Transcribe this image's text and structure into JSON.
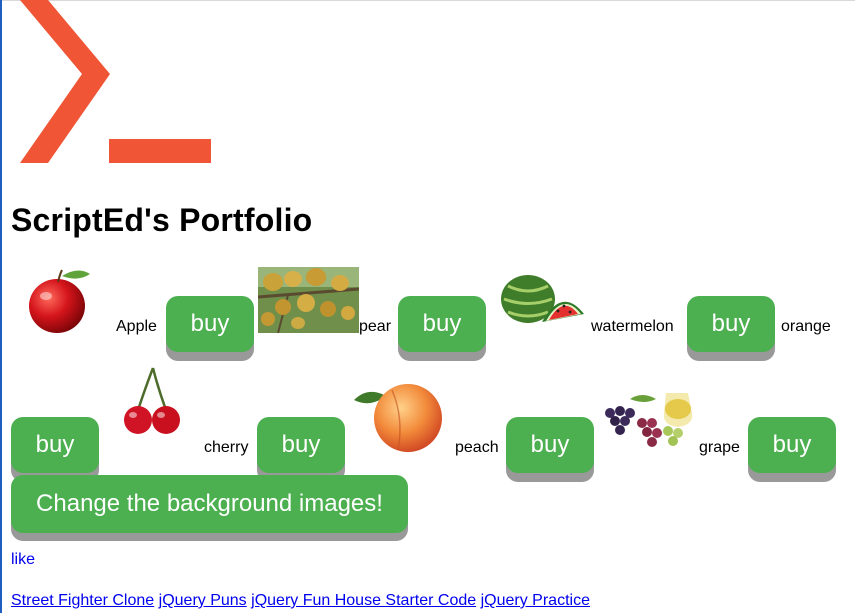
{
  "page": {
    "title": "ScriptEd's Portfolio",
    "brand_color": "#f05535",
    "button_color": "#4caf50",
    "button_shadow_color": "#999999",
    "link_color": "#0000ee"
  },
  "logo": {
    "icon": "terminal-prompt-icon"
  },
  "fruits": [
    {
      "label": "Apple",
      "button": "buy",
      "icon": "apple-image"
    },
    {
      "label": "pear",
      "button": "buy",
      "icon": "pear-tree-image"
    },
    {
      "label": "watermelon",
      "button": "buy",
      "icon": "watermelon-image"
    },
    {
      "label": "orange",
      "button": "buy",
      "icon": "orange-image"
    },
    {
      "label": "cherry",
      "button": "buy",
      "icon": "cherry-image"
    },
    {
      "label": "peach",
      "button": "buy",
      "icon": "peach-image"
    },
    {
      "label": "grape",
      "button": "buy",
      "icon": "grape-image"
    }
  ],
  "change_button": "Change the background images!",
  "like_link": "like",
  "footer_links": [
    "Street Fighter Clone",
    "jQuery Puns",
    "jQuery Fun House Starter Code",
    "jQuery Practice"
  ]
}
